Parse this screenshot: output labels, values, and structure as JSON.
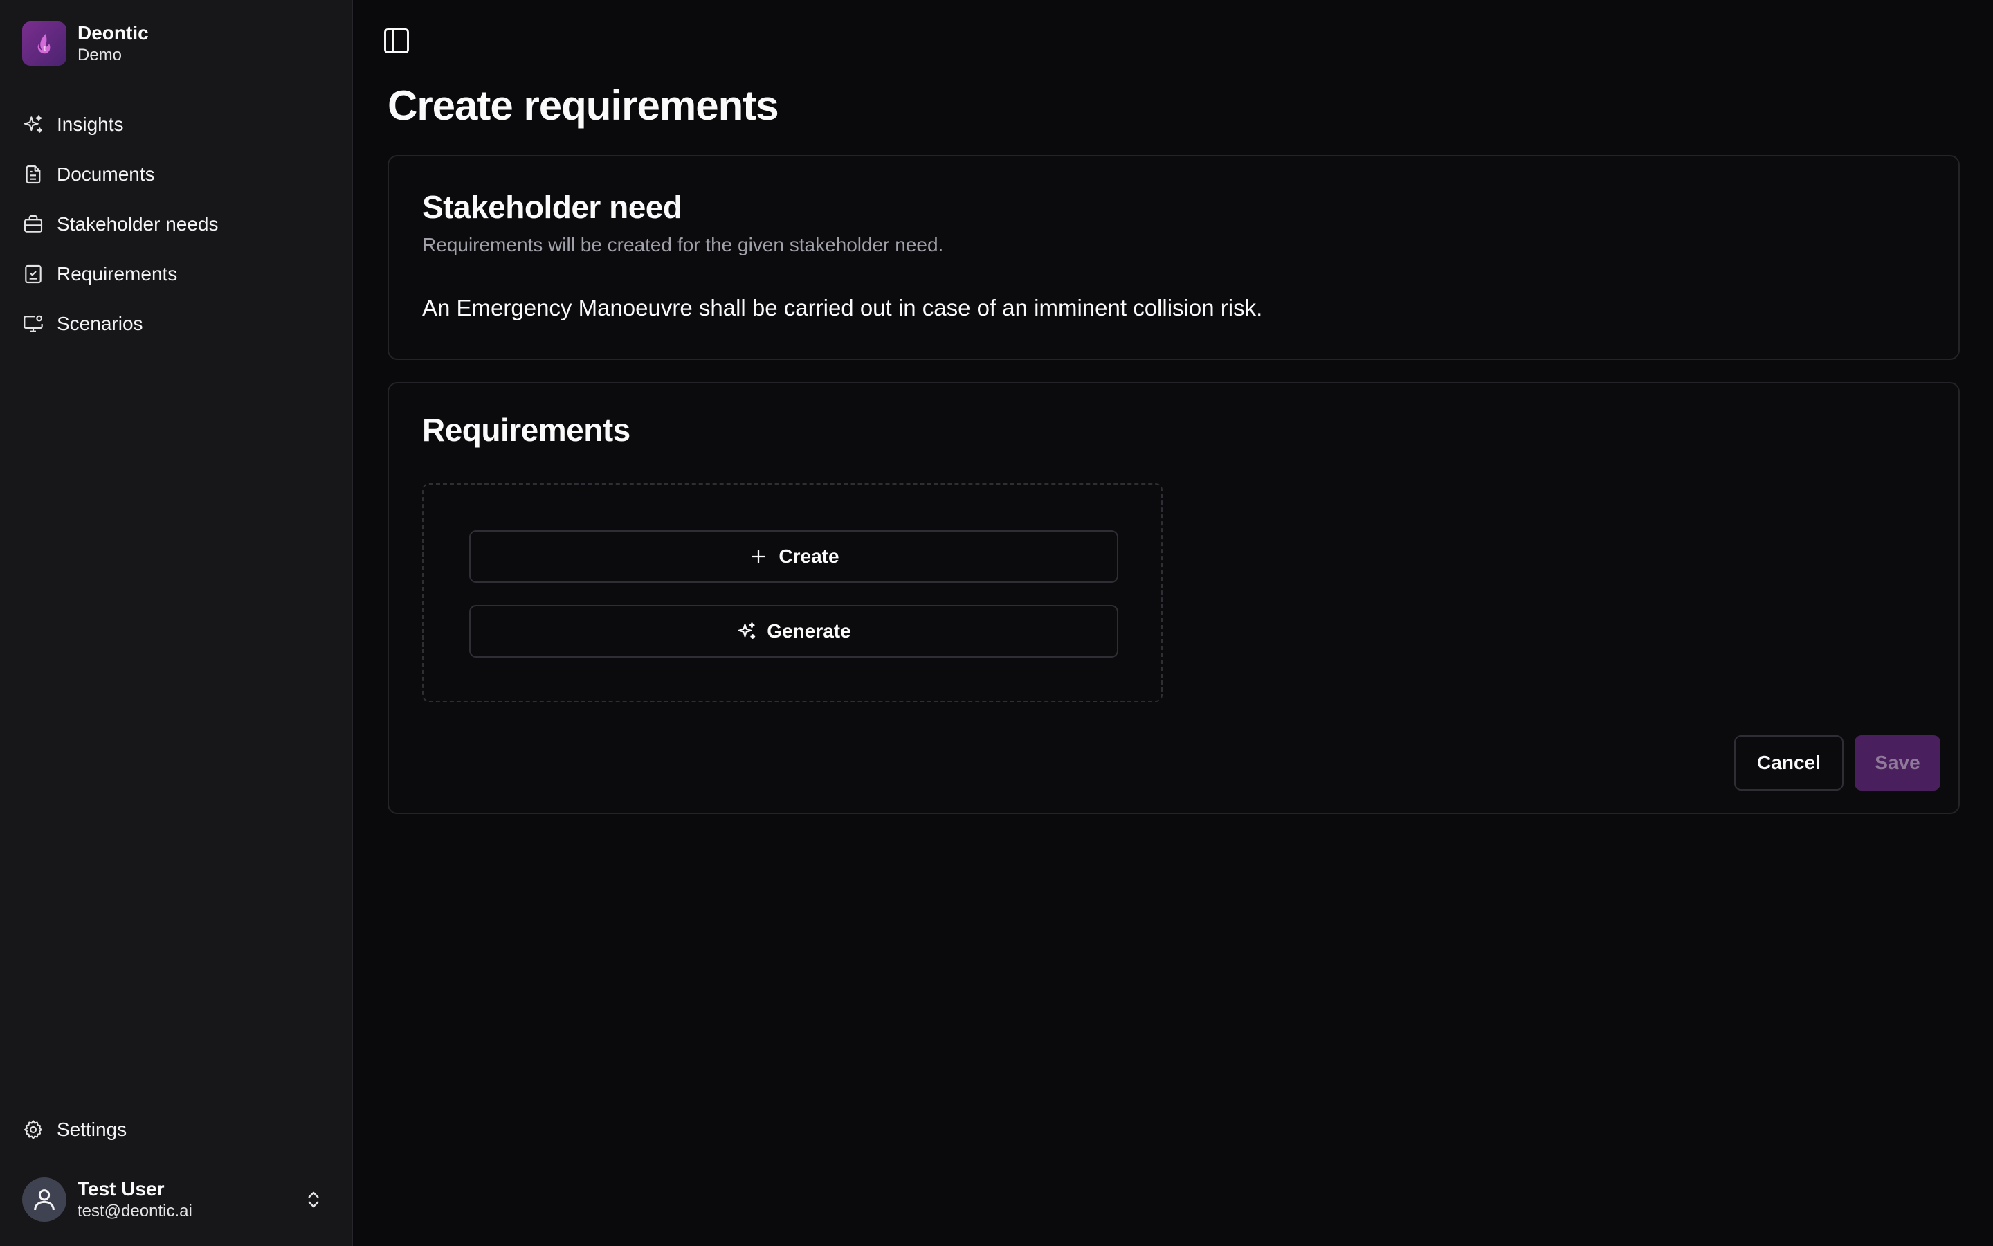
{
  "brand": {
    "name": "Deontic",
    "workspace": "Demo",
    "logo_color": "#7a2e8e"
  },
  "sidebar": {
    "items": [
      {
        "label": "Insights",
        "icon": "sparkles-icon"
      },
      {
        "label": "Documents",
        "icon": "document-icon"
      },
      {
        "label": "Stakeholder needs",
        "icon": "briefcase-icon"
      },
      {
        "label": "Requirements",
        "icon": "checklist-icon"
      },
      {
        "label": "Scenarios",
        "icon": "monitor-icon"
      }
    ],
    "settings_label": "Settings",
    "user": {
      "name": "Test User",
      "email": "test@deontic.ai"
    }
  },
  "page": {
    "title": "Create requirements"
  },
  "stakeholder_need": {
    "title": "Stakeholder need",
    "description": "Requirements will be created for the given stakeholder need.",
    "text": "An Emergency Manoeuvre shall be carried out in case of an imminent collision risk."
  },
  "requirements": {
    "title": "Requirements",
    "create_label": "Create",
    "generate_label": "Generate",
    "cancel_label": "Cancel",
    "save_label": "Save"
  },
  "colors": {
    "accent": "#4a1f5e",
    "background": "#0a0a0c",
    "sidebar": "#17171a"
  }
}
